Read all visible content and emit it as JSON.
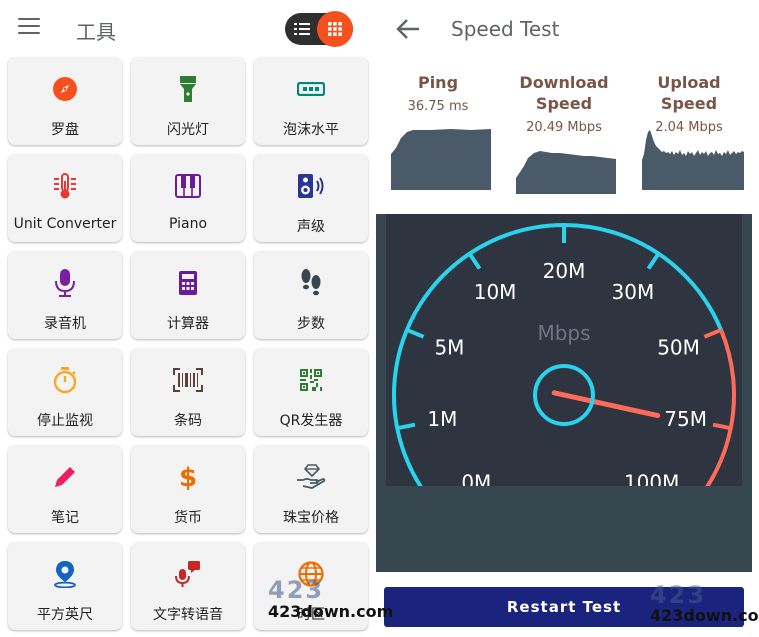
{
  "left": {
    "title": "工具",
    "tools": [
      {
        "label": "罗盘",
        "icon": "compass-icon",
        "color": "#f4511e"
      },
      {
        "label": "闪光灯",
        "icon": "flashlight-icon",
        "color": "#2e7d32"
      },
      {
        "label": "泡沫水平",
        "icon": "bubble-level-icon",
        "color": "#00897b"
      },
      {
        "label": "Unit Converter",
        "icon": "thermometer-icon",
        "color": "#e53935"
      },
      {
        "label": "Piano",
        "icon": "piano-icon",
        "color": "#6a1b9a"
      },
      {
        "label": "声级",
        "icon": "speaker-icon",
        "color": "#283593"
      },
      {
        "label": "录音机",
        "icon": "microphone-icon",
        "color": "#7b1fa2"
      },
      {
        "label": "计算器",
        "icon": "calculator-icon",
        "color": "#6a1b9a"
      },
      {
        "label": "步数",
        "icon": "footsteps-icon",
        "color": "#37474f"
      },
      {
        "label": "停止监视",
        "icon": "stopwatch-icon",
        "color": "#f9a825"
      },
      {
        "label": "条码",
        "icon": "barcode-icon",
        "color": "#5d4037"
      },
      {
        "label": "QR发生器",
        "icon": "qr-code-icon",
        "color": "#2e7d32"
      },
      {
        "label": "笔记",
        "icon": "pencil-icon",
        "color": "#e91e63"
      },
      {
        "label": "货币",
        "icon": "dollar-icon",
        "color": "#ef6c00"
      },
      {
        "label": "珠宝价格",
        "icon": "jewel-hand-icon",
        "color": "#455a64"
      },
      {
        "label": "平方英尺",
        "icon": "map-pin-icon",
        "color": "#1565c0"
      },
      {
        "label": "文字转语音",
        "icon": "voice-message-icon",
        "color": "#c62828"
      },
      {
        "label": "时区",
        "icon": "globe-icon",
        "color": "#ef6c00"
      }
    ]
  },
  "right": {
    "title": "Speed Test",
    "ping": {
      "label": "Ping",
      "value": "36.75 ms"
    },
    "download": {
      "label": "Download Speed",
      "value": "20.49 Mbps"
    },
    "upload": {
      "label": "Upload Speed",
      "value": "2.04 Mbps"
    },
    "gauge": {
      "unit": "Mbps",
      "ticks": [
        "0M",
        "1M",
        "5M",
        "10M",
        "20M",
        "30M",
        "50M",
        "75M",
        "100M"
      ],
      "needle_tick_position": 1.7,
      "arc_color": "#29d3ec",
      "high_color": "#ff6b5a",
      "needle_color": "#ff6b5a"
    },
    "restart_label": "Restart Test"
  },
  "watermark": {
    "big": "423",
    "small": "423down.com"
  }
}
